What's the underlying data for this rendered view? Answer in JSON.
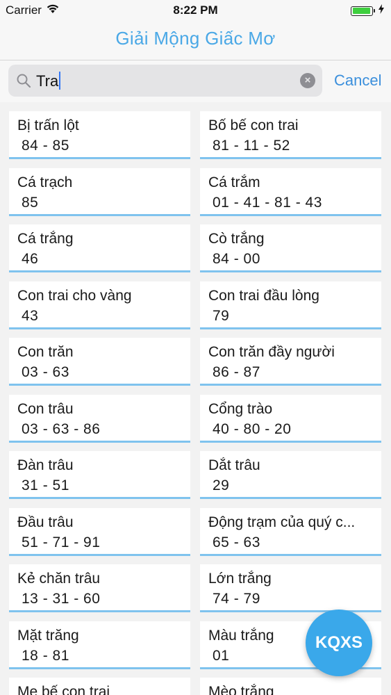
{
  "status_bar": {
    "carrier": "Carrier",
    "time": "8:22 PM",
    "battery_level": 0.95
  },
  "nav": {
    "title": "Giải Mộng Giấc Mơ"
  },
  "search": {
    "value": "Tra",
    "cancel_label": "Cancel"
  },
  "results": [
    {
      "name": "Bị trấn lột",
      "numbers": "84 - 85"
    },
    {
      "name": "Bố bế con trai",
      "numbers": "81 - 11 - 52"
    },
    {
      "name": "Cá trạch",
      "numbers": "85"
    },
    {
      "name": "Cá trắm",
      "numbers": "01 - 41 - 81 - 43"
    },
    {
      "name": "Cá trắng",
      "numbers": "46"
    },
    {
      "name": "Cò trắng",
      "numbers": "84 - 00"
    },
    {
      "name": "Con trai cho vàng",
      "numbers": "43"
    },
    {
      "name": "Con trai đầu lòng",
      "numbers": "79"
    },
    {
      "name": "Con trăn",
      "numbers": "03 - 63"
    },
    {
      "name": "Con trăn đầy người",
      "numbers": "86 - 87"
    },
    {
      "name": "Con trâu",
      "numbers": "03 - 63 - 86"
    },
    {
      "name": "Cổng trào",
      "numbers": "40 - 80 - 20"
    },
    {
      "name": "Đàn trâu",
      "numbers": "31 - 51"
    },
    {
      "name": "Dắt trâu",
      "numbers": "29"
    },
    {
      "name": "Đầu trâu",
      "numbers": "51 - 71 - 91"
    },
    {
      "name": "Động trạm của quý c...",
      "numbers": "65 - 63"
    },
    {
      "name": "Kẻ chăn trâu",
      "numbers": "13 - 31 - 60"
    },
    {
      "name": "Lớn trắng",
      "numbers": "74 - 79"
    },
    {
      "name": "Mặt trăng",
      "numbers": "18 - 81"
    },
    {
      "name": "Màu trắng",
      "numbers": "01"
    },
    {
      "name": "Mẹ bế con trai",
      "numbers": ""
    },
    {
      "name": "Mèo trắng",
      "numbers": ""
    }
  ],
  "fab": {
    "label": "KQXS"
  },
  "colors": {
    "accent": "#4aa8e6",
    "card_underline": "#7fc3ee",
    "fab": "#3aa8ea"
  }
}
